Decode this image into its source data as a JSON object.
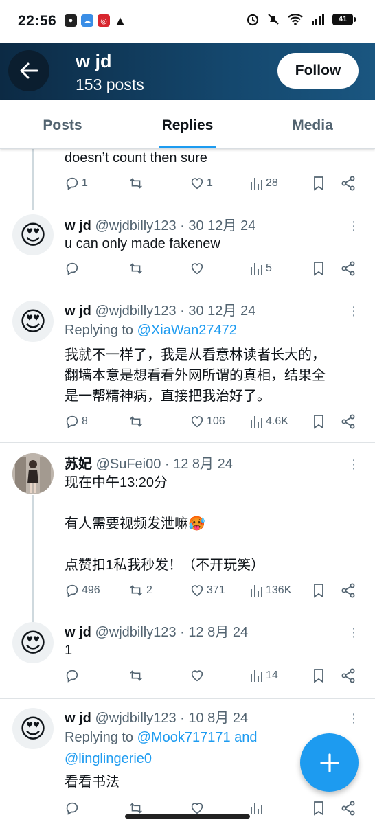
{
  "status_bar": {
    "time": "22:56",
    "battery": "41"
  },
  "header": {
    "name": "w jd",
    "posts_count": "153 posts",
    "follow_label": "Follow"
  },
  "tabs": [
    {
      "label": "Posts"
    },
    {
      "label": "Replies",
      "active": true
    },
    {
      "label": "Media"
    }
  ],
  "posts": [
    {
      "display_name": "",
      "handle": "",
      "text": "doesn’t count then sure",
      "stats": {
        "replies": "1",
        "reposts": "",
        "likes": "1",
        "views": "28"
      }
    },
    {
      "display_name": "w jd",
      "handle": "@wjdbilly123 · 30 12月 24",
      "avatar_icon": "heart-eyes-emoji",
      "text": "u can only made fakenew",
      "stats": {
        "replies": "",
        "reposts": "",
        "likes": "",
        "views": "5"
      }
    },
    {
      "display_name": "w jd",
      "handle": "@wjdbilly123 · 30 12月 24",
      "avatar_icon": "heart-eyes-emoji",
      "replying_prefix": "Replying to ",
      "replying_to": "@XiaWan27472",
      "text": "我就不一样了，我是从看意林读者长大的，\n翻墙本意是想看看外网所谓的真相，结果全\n是一帮精神病，直接把我治好了。",
      "stats": {
        "replies": "8",
        "reposts": "",
        "likes": "106",
        "views": "4.6K"
      }
    },
    {
      "display_name": "苏妃",
      "handle": "@SuFei00 · 12 8月 24",
      "avatar_icon": "profile-photo",
      "text": "现在中午13:20分\n\n有人需要视频发泄嘛🥵\n\n点赞扣1私我秒发！（不开玩笑）",
      "stats": {
        "replies": "496",
        "reposts": "2",
        "likes": "371",
        "views": "136K"
      }
    },
    {
      "display_name": "w jd",
      "handle": "@wjdbilly123 · 12 8月 24",
      "avatar_icon": "heart-eyes-emoji",
      "text": "1",
      "stats": {
        "replies": "",
        "reposts": "",
        "likes": "",
        "views": "14"
      }
    },
    {
      "display_name": "w jd",
      "handle": "@wjdbilly123 · 10 8月 24",
      "avatar_icon": "heart-eyes-emoji",
      "replying_prefix": "Replying to ",
      "replying_to": "@Mook717171 and",
      "replying_to_2": "@linglingerie0",
      "text": "看看书法",
      "stats": {
        "replies": "",
        "reposts": "",
        "likes": "",
        "views": ""
      }
    }
  ],
  "colors": {
    "accent": "#1d9bf0",
    "header_bg": "#14476d",
    "secondary_text": "#536471"
  }
}
